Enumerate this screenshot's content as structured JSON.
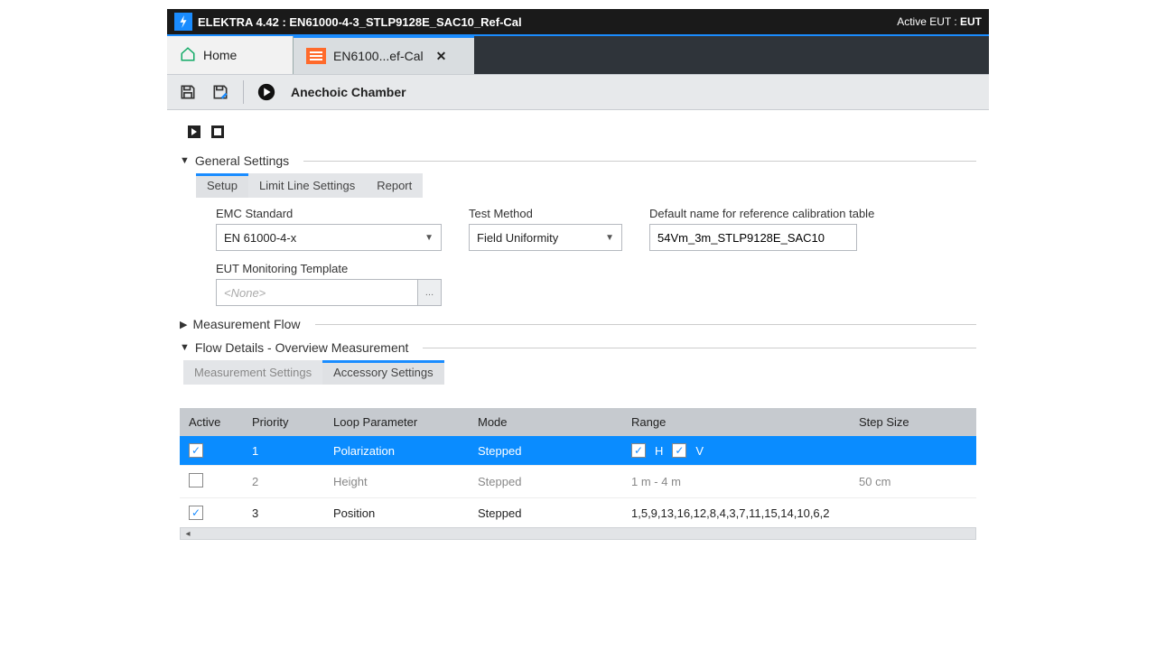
{
  "titlebar": {
    "app": "ELEKTRA 4.42",
    "document": "EN61000-4-3_STLP9128E_SAC10_Ref-Cal",
    "active_eut_label": "Active EUT :",
    "active_eut_value": "EUT"
  },
  "tabs": {
    "home": "Home",
    "doc": "EN6100...ef-Cal"
  },
  "toolbar": {
    "save_title": "Save",
    "saveas_title": "Save As",
    "run_title": "Run",
    "location": "Anechoic Chamber"
  },
  "sections": {
    "general": {
      "title": "General Settings",
      "subtabs": [
        "Setup",
        "Limit Line Settings",
        "Report"
      ],
      "emc_standard_label": "EMC Standard",
      "emc_standard_value": "EN 61000-4-x",
      "test_method_label": "Test Method",
      "test_method_value": "Field Uniformity",
      "default_name_label": "Default name for reference calibration table",
      "default_name_value": "54Vm_3m_STLP9128E_SAC10",
      "eut_template_label": "EUT Monitoring Template",
      "eut_template_placeholder": "<None>"
    },
    "measurement_flow": {
      "title": "Measurement Flow"
    },
    "flow_details": {
      "title": "Flow Details  -  Overview Measurement",
      "subtabs": [
        "Measurement Settings",
        "Accessory Settings"
      ]
    }
  },
  "table": {
    "headers": [
      "Active",
      "Priority",
      "Loop Parameter",
      "Mode",
      "Range",
      "Step Size"
    ],
    "rows": [
      {
        "active": true,
        "priority": "1",
        "param": "Polarization",
        "mode": "Stepped",
        "range_h": true,
        "range_v": true,
        "range_text": "",
        "step": "",
        "selected": true
      },
      {
        "active": false,
        "priority": "2",
        "param": "Height",
        "mode": "Stepped",
        "range_text": "1 m  -  4 m",
        "step": "50 cm",
        "dim": true
      },
      {
        "active": true,
        "priority": "3",
        "param": "Position",
        "mode": "Stepped",
        "range_text": "1,5,9,13,16,12,8,4,3,7,11,15,14,10,6,2",
        "step": ""
      }
    ],
    "hv_labels": {
      "h": "H",
      "v": "V"
    }
  }
}
